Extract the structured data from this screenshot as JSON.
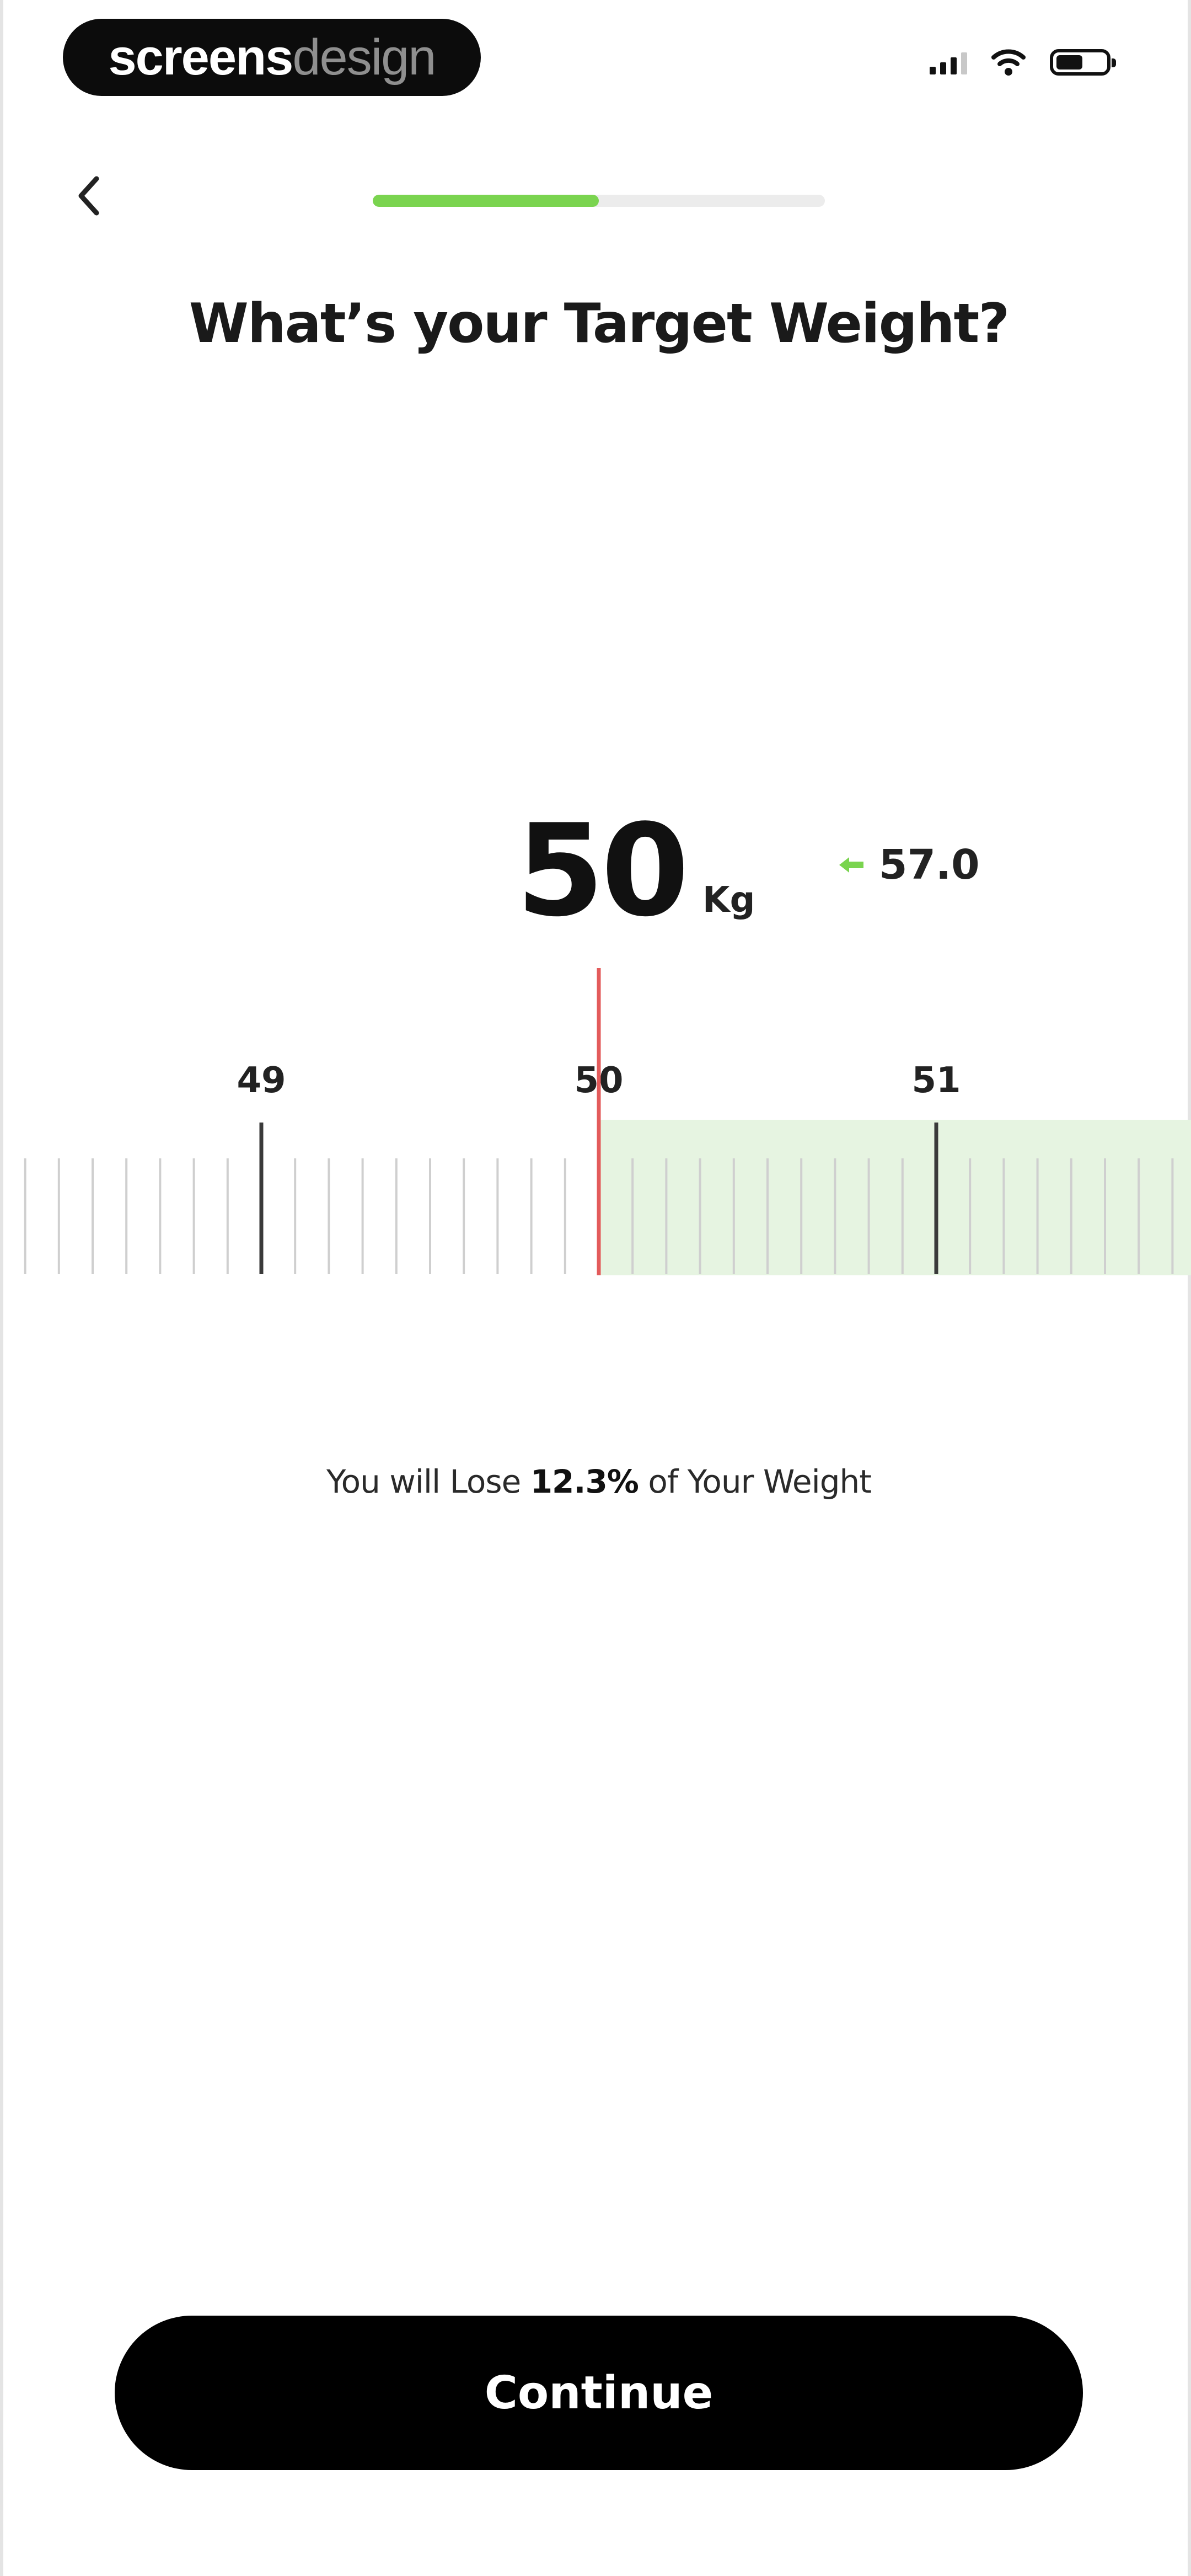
{
  "status_bar": {
    "watermark_part1": "screens",
    "watermark_part2": "design",
    "icons": [
      "cellular-signal-icon",
      "wifi-icon",
      "battery-icon"
    ],
    "battery_level": 0.55
  },
  "header": {
    "back_icon": "chevron-left-icon",
    "progress": 0.5,
    "progress_color": "#7ad44f"
  },
  "title": "What’s your Target Weight?",
  "selection": {
    "value": "50",
    "unit": "Kg",
    "current_weight": "57.0",
    "current_icon": "arrow-left-icon",
    "accent_color": "#7ad44f"
  },
  "ruler": {
    "labels": [
      "49",
      "50",
      "51"
    ],
    "min": 49,
    "max": 51,
    "selected": 50,
    "minor_steps_per_unit": 10,
    "indicator_color": "#e35b5b",
    "range_color": "#e6f4e1"
  },
  "message": {
    "prefix": "You will Lose ",
    "percent": "12.3%",
    "suffix": " of Your Weight"
  },
  "continue_label": "Continue"
}
